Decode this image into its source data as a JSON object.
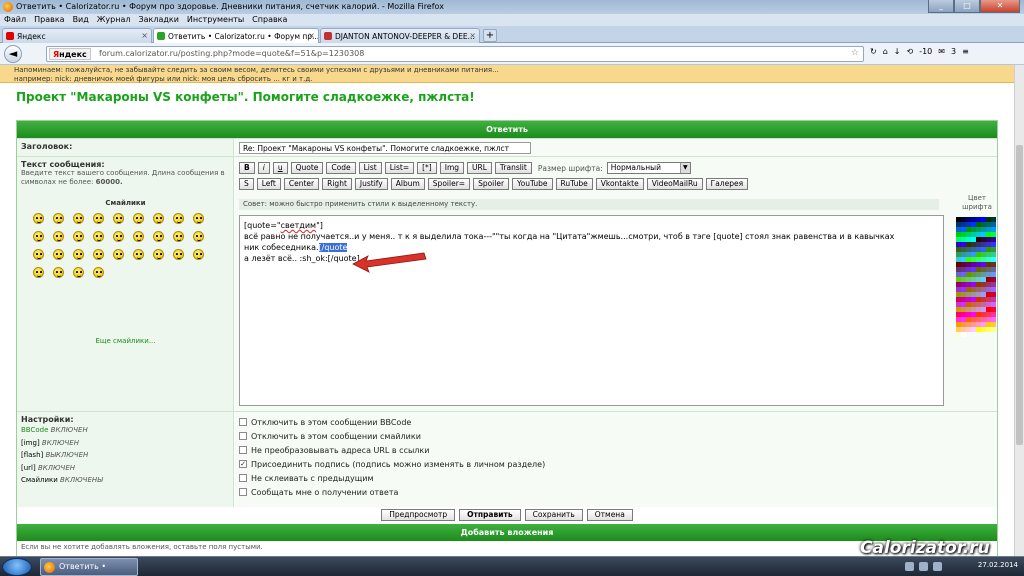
{
  "window": {
    "title": "Ответить • Calorizator.ru • Форум про здоровье. Дневники питания, счетчик калорий. - Mozilla Firefox"
  },
  "menu": [
    "Файл",
    "Правка",
    "Вид",
    "Журнал",
    "Закладки",
    "Инструменты",
    "Справка"
  ],
  "tabs": [
    {
      "label": "Яндекс",
      "icon_color": "#e00000",
      "active": false
    },
    {
      "label": "Ответить • Calorizator.ru • Форум пр...",
      "icon_color": "#2aa52a",
      "active": true
    },
    {
      "label": "DJANTON ANTONOV-DEEPER & DEE...",
      "icon_color": "#c23030",
      "active": false
    }
  ],
  "newtab_label": "+",
  "nav": {
    "back_label": "◄",
    "yandex_label_y": "Я",
    "yandex_label_rest": "ндекс",
    "url": "forum.calorizator.ru/posting.php?mode=quote&f=51&p=1230308",
    "star": "☆",
    "counter": "-10",
    "badge": "3"
  },
  "notice": {
    "line1": "Напоминаем: пожалуйста, не забывайте следить за своим весом, делитесь своими успехами с друзьями и дневниками питания...",
    "line2": "например: nick: дневничок моей фигуры или nick: моя цель сбросить ... кг и т.д."
  },
  "page_title": "Проект \"Макароны VS конфеты\". Помогите сладкоежке, пжлста!",
  "form": {
    "header": "Ответить",
    "subject_label": "Заголовок:",
    "subject_value": "Re: Проект \"Макароны VS конфеты\". Помогите сладкоежке, пжлст",
    "message_label": "Текст сообщения:",
    "message_hint": "Введите текст вашего сообщения. Длина сообщения в символах не более:",
    "message_max": "60000.",
    "smilies_title": "Смайлики",
    "more_smilies": "Еще смайлики...",
    "bbcode_row1": [
      "B",
      "i",
      "u",
      "Quote",
      "Code",
      "List",
      "List=",
      "[*]",
      "Img",
      "URL",
      "Translit"
    ],
    "bbcode_row2": [
      "S",
      "Left",
      "Center",
      "Right",
      "Justify",
      "Album",
      "Spoiler=",
      "Spoiler",
      "YouTube",
      "RuTube",
      "Vkontakte",
      "VideoMailRu",
      "Галерея"
    ],
    "font_size_label": "Размер шрифта:",
    "font_size_value": "Нормальный",
    "tip": "Совет: можно быстро применить стили к выделенному тексту.",
    "color_title": "Цвет шрифта",
    "textarea": {
      "l1_pre": "[quote=\"",
      "l1_name": "светдим",
      "l1_post": "\"]",
      "l2": "всё равно не получается..и у меня.. т к я выделила тока---\"\"ты когда на \"Цитата\"жмешь...смотри, чтоб в тэге [quote] стоял знак равенства и в кавычках",
      "l3_pre": "ник собеседника.",
      "l3_sel": "[/quote",
      "l3_post": "",
      "l4": "",
      "l5": "а лезёт всё.. :sh_ok:[/quote]"
    }
  },
  "settings": {
    "label": "Настройки:",
    "items": [
      {
        "name": "BBCode",
        "state": "ВКЛЮЧЕН"
      },
      {
        "name": "[img]",
        "state": "ВКЛЮЧЕН"
      },
      {
        "name": "[flash]",
        "state": "ВЫКЛЮЧЕН"
      },
      {
        "name": "[url]",
        "state": "ВКЛЮЧЕН"
      },
      {
        "name": "Смайлики",
        "state": "ВКЛЮЧЕНЫ"
      }
    ],
    "options": [
      {
        "label": "Отключить в этом сообщении BBCode",
        "checked": false
      },
      {
        "label": "Отключить в этом сообщении смайлики",
        "checked": false
      },
      {
        "label": "Не преобразовывать адреса URL в ссылки",
        "checked": false
      },
      {
        "label": "Присоединить подпись (подпись можно изменять в личном разделе)",
        "checked": true
      },
      {
        "label": "Не склеивать с предыдущим",
        "checked": false
      },
      {
        "label": "Сообщать мне о получении ответа",
        "checked": false
      }
    ]
  },
  "actions": [
    "Предпросмотр",
    "Отправить",
    "Сохранить",
    "Отмена"
  ],
  "attachments": {
    "header": "Добавить вложения",
    "note": "Если вы не хотите добавлять вложения, оставьте поля пустыми."
  },
  "taskbar": {
    "item": "Ответить • Calori...",
    "clock": "27.02.2014"
  },
  "watermark": "Calorizator.ru"
}
